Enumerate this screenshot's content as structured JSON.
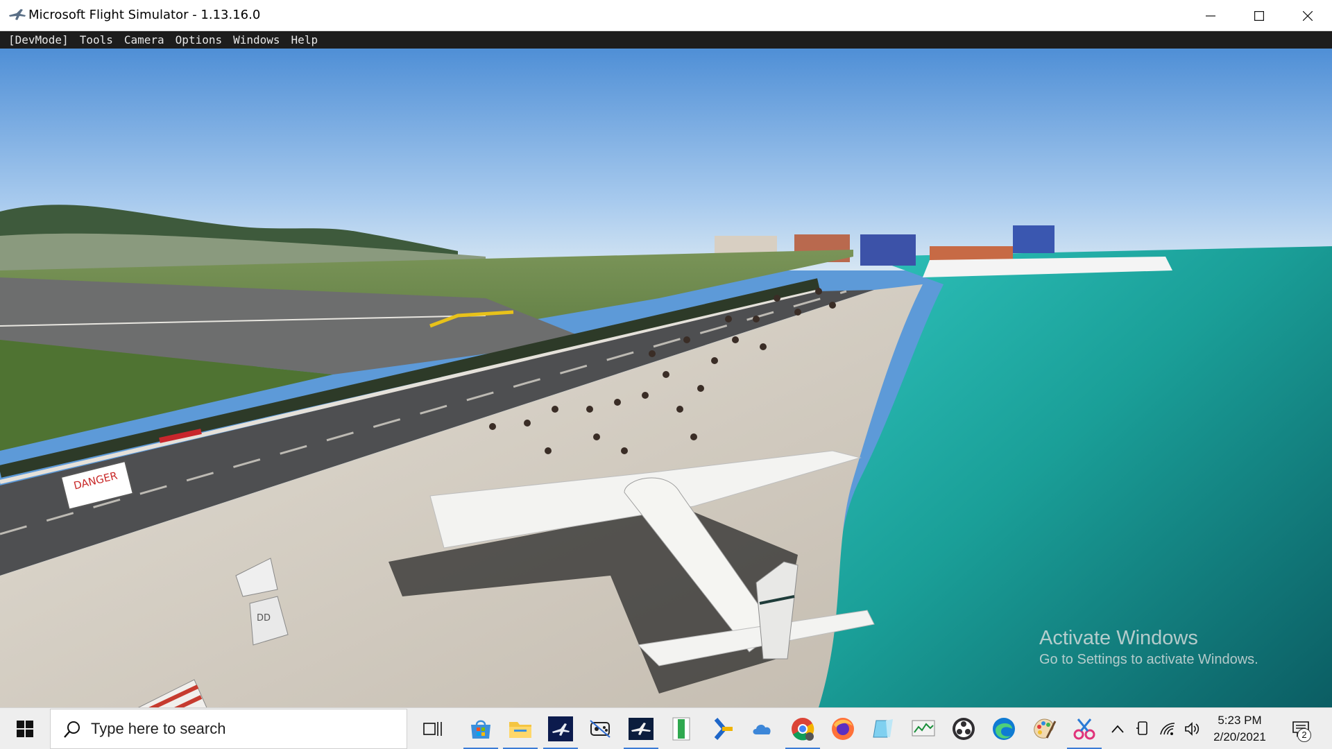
{
  "window": {
    "title": "Microsoft Flight Simulator - 1.13.16.0"
  },
  "menubar": {
    "items": [
      "[DevMode]",
      "Tools",
      "Camera",
      "Options",
      "Windows",
      "Help"
    ]
  },
  "scene": {
    "sign_text": "DANGER",
    "barrier_text": "DD"
  },
  "watermark": {
    "title": "Activate Windows",
    "subtitle": "Go to Settings to activate Windows."
  },
  "taskbar": {
    "search_placeholder": "Type here to search",
    "pinned_apps": [
      {
        "name": "task-view",
        "running": false
      },
      {
        "name": "microsoft-store",
        "running": true
      },
      {
        "name": "file-explorer",
        "running": true
      },
      {
        "name": "flight-simulator",
        "running": true
      },
      {
        "name": "game-controller-app",
        "running": false
      },
      {
        "name": "airplane-app",
        "running": true
      },
      {
        "name": "green-document-app",
        "running": false
      },
      {
        "name": "xbox-game-bar",
        "running": false
      },
      {
        "name": "onedrive",
        "running": false
      },
      {
        "name": "chrome",
        "running": true
      },
      {
        "name": "firefox",
        "running": false
      },
      {
        "name": "notepad",
        "running": false
      },
      {
        "name": "task-manager",
        "running": false
      },
      {
        "name": "obs",
        "running": false
      },
      {
        "name": "edge",
        "running": false
      },
      {
        "name": "paint",
        "running": false
      },
      {
        "name": "snip-sketch",
        "running": true
      }
    ],
    "clock": {
      "time": "5:23 PM",
      "date": "2/20/2021"
    },
    "notification_count": "2"
  }
}
